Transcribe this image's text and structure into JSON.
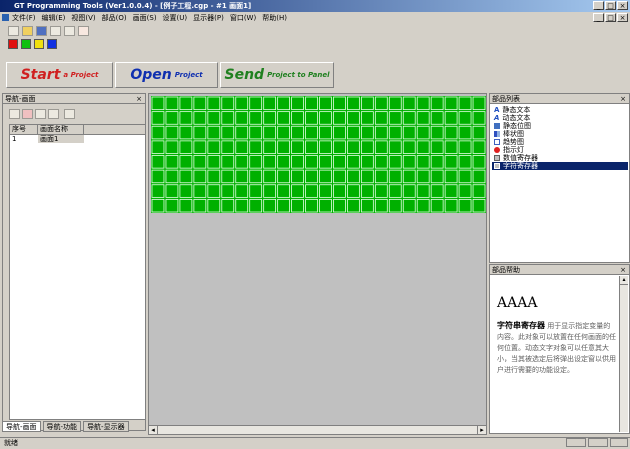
{
  "window": {
    "title": "GT Programming Tools (Ver1.0.0.4) - [例子工程.cgp - #1 画面1]"
  },
  "menu": [
    "文件(F)",
    "编辑(E)",
    "视图(V)",
    "部品(O)",
    "画面(S)",
    "设置(U)",
    "显示器(P)",
    "窗口(W)",
    "帮助(H)"
  ],
  "colors": {
    "grid_green": "#00b000",
    "selection": "#0a246a",
    "red": "#e01010",
    "green": "#10c010",
    "yellow": "#f0e010",
    "blue": "#1030e0"
  },
  "quickbar": [
    {
      "big": "Start",
      "small": "a Project",
      "color": "#d02020"
    },
    {
      "big": "Open",
      "small": "Project",
      "color": "#1030b0"
    },
    {
      "big": "Send",
      "small": "Project to Panel",
      "color": "#208020"
    }
  ],
  "left_panel": {
    "title": "导航-画面",
    "close": "×",
    "columns": [
      "序号",
      "画面名称"
    ],
    "rows": [
      {
        "num": "1",
        "name": "画面1"
      }
    ],
    "tabs": [
      "导航-画面",
      "导航-功能",
      "导航-显示器"
    ]
  },
  "parts_panel": {
    "title": "部品列表",
    "close": "×",
    "items": [
      {
        "label": "静态文本",
        "icon": "A",
        "selected": false
      },
      {
        "label": "动态文本",
        "icon": "A",
        "selected": false
      },
      {
        "label": "静态位图",
        "icon": "bitmap-icon",
        "selected": false
      },
      {
        "label": "棒状图",
        "icon": "bar-icon",
        "selected": false
      },
      {
        "label": "趋势图",
        "icon": "trend-icon",
        "selected": false
      },
      {
        "label": "指示灯",
        "icon": "lamp-icon",
        "selected": false
      },
      {
        "label": "数值寄存器",
        "icon": "register-icon",
        "selected": false
      },
      {
        "label": "字符寄存器",
        "icon": "register-icon",
        "selected": true
      }
    ]
  },
  "help_panel": {
    "title": "部品帮助",
    "close": "×",
    "heading": "AAAA",
    "name": "字符串寄存器",
    "text": "用于显示指定变量的内容。此对象可以放置在任何画面的任何位置。动态文字对象可以任意其大小，当其被选定后将弹出设定窗以供用户进行需要的功能设定。"
  },
  "status": {
    "text": "就绪"
  }
}
